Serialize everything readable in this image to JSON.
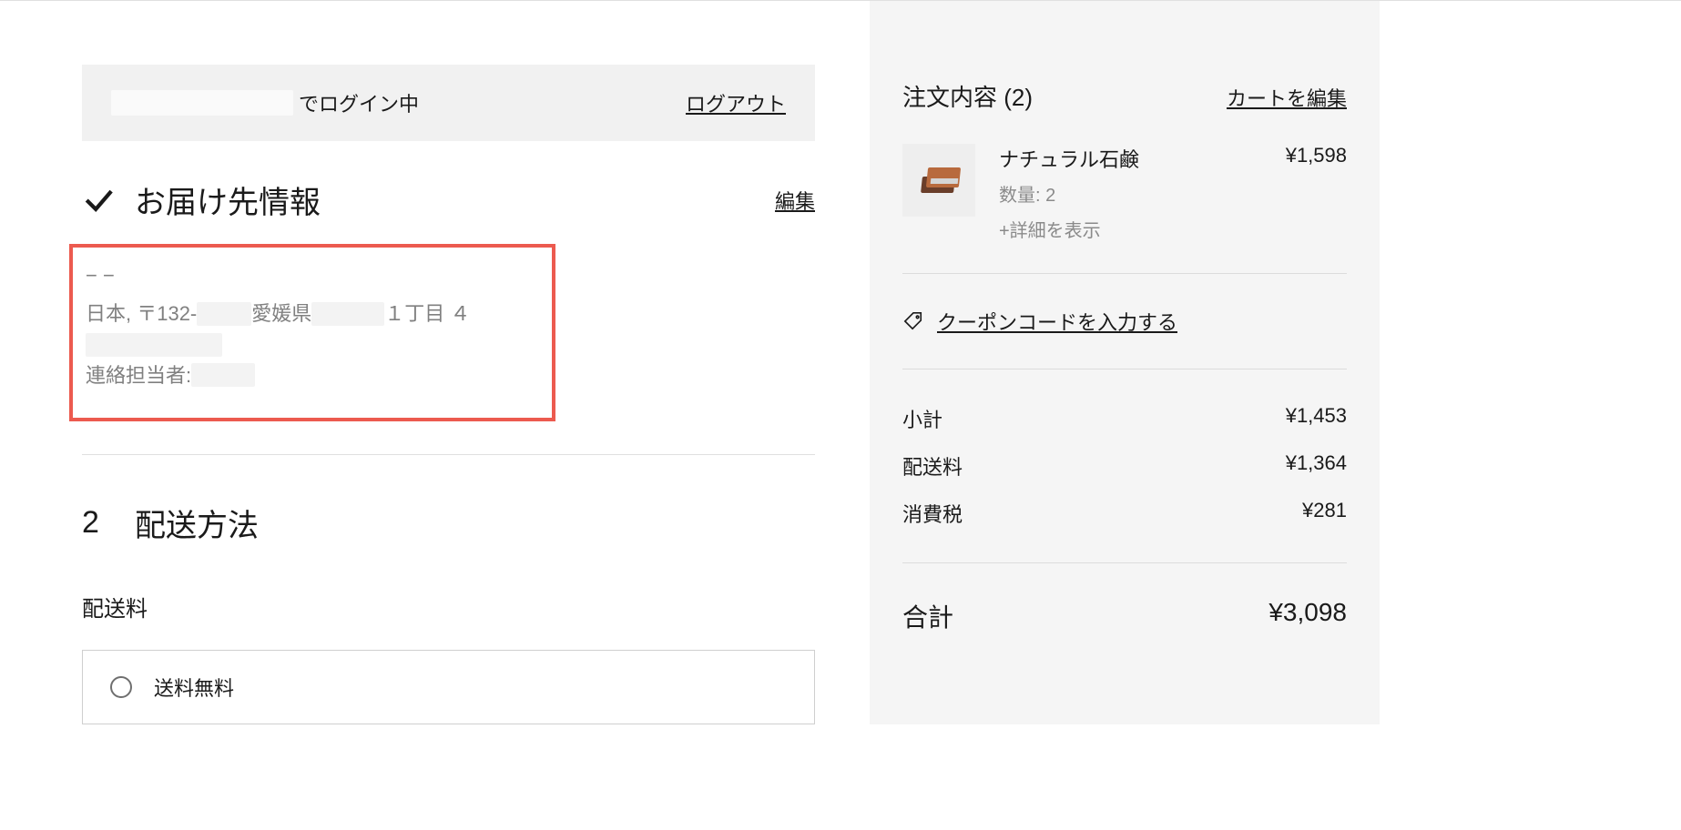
{
  "login": {
    "logged_in_suffix": "でログイン中",
    "logout": "ログアウト"
  },
  "delivery": {
    "title": "お届け先情報",
    "edit": "編集",
    "line1": "− −",
    "addr_prefix": "日本, 〒132-",
    "addr_mid": " 愛媛県",
    "addr_suffix": "１丁目 ４",
    "contact_label": "連絡担当者: "
  },
  "shipping": {
    "step": "2",
    "title": "配送方法",
    "sub_label": "配送料",
    "option_free": "送料無料"
  },
  "order": {
    "title_base": "注文内容",
    "count": 2,
    "edit_cart": "カートを編集",
    "item": {
      "name": "ナチュラル石鹸",
      "price": "¥1,598",
      "qty_label": "数量: ",
      "qty": 2,
      "more": "+詳細を表示"
    },
    "coupon": "クーポンコードを入力する",
    "subtotal_label": "小計",
    "subtotal": "¥1,453",
    "shipping_label": "配送料",
    "shipping_cost": "¥1,364",
    "tax_label": "消費税",
    "tax": "¥281",
    "total_label": "合計",
    "total": "¥3,098"
  }
}
